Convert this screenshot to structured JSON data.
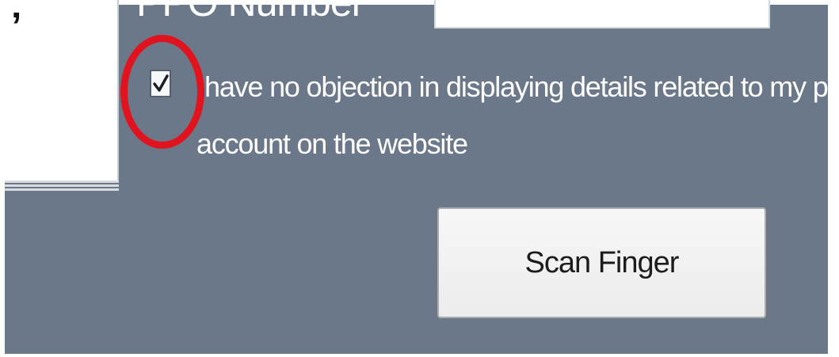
{
  "form": {
    "field_label": "PPO Number",
    "field_value": "",
    "consent": {
      "checked": true,
      "line1": "have no objection in displaying details related to my pension",
      "line2": "account on the website"
    },
    "scan_button_label": "Scan Finger",
    "left_glyph": "’"
  },
  "colors": {
    "panel": "#6b7889",
    "highlight_ring": "#e0131f",
    "text": "#ffffff",
    "button": "#f2f2f2"
  },
  "icons": {
    "checkbox": "checkmark-icon"
  }
}
